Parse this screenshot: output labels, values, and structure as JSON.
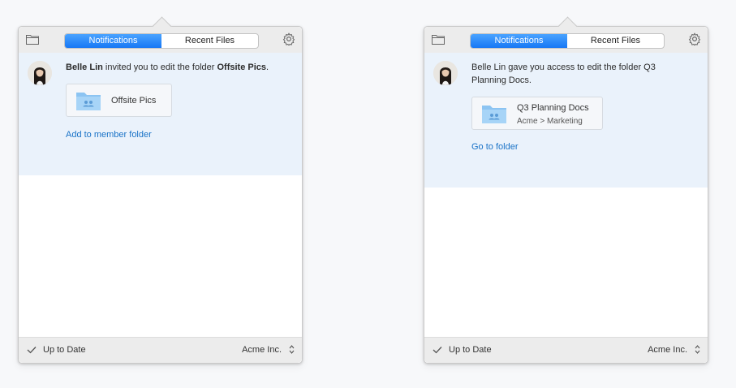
{
  "panels": [
    {
      "tabs": [
        "Notifications",
        "Recent Files"
      ],
      "notification": {
        "sender": "Belle Lin",
        "action": "invited you to edit the folder",
        "folder": "Offsite Pics",
        "trailing": ".",
        "file_card": {
          "name": "Offsite Pics",
          "path": ""
        },
        "link": "Add to member folder"
      },
      "footer": {
        "status": "Up to Date",
        "account": "Acme Inc."
      }
    },
    {
      "tabs": [
        "Notifications",
        "Recent Files"
      ],
      "notification": {
        "text": "Belle Lin gave you access to edit the folder Q3 Planning Docs.",
        "file_card": {
          "name": "Q3 Planning Docs",
          "path": "Acme > Marketing"
        },
        "link": "Go to folder"
      },
      "footer": {
        "status": "Up to Date",
        "account": "Acme Inc."
      }
    }
  ],
  "colors": {
    "accent": "#1677f5",
    "link": "#1a73c7",
    "notification_bg": "#eaf2fb",
    "toolbar_bg": "#ececec"
  },
  "icons": [
    "folder-icon",
    "gear-icon",
    "avatar",
    "shared-folder-icon",
    "checkmark-icon",
    "updown-chevron-icon"
  ]
}
